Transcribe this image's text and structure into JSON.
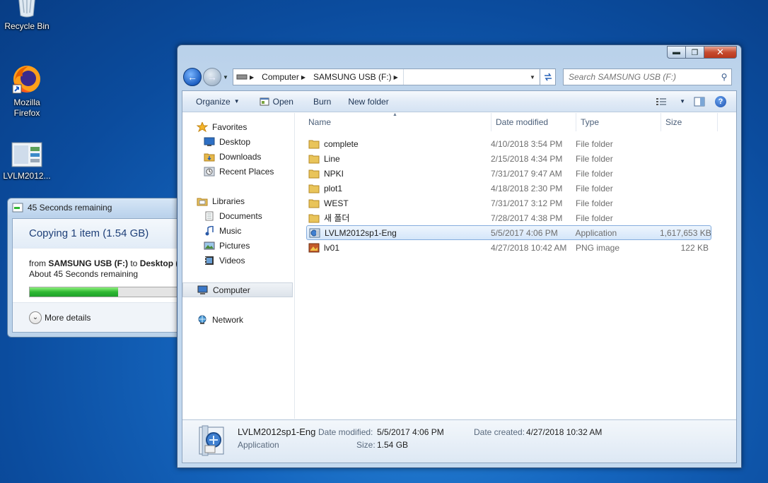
{
  "desktop": {
    "icons": [
      {
        "label": "Recycle Bin"
      },
      {
        "label": "Mozilla Firefox"
      },
      {
        "label": "LVLM2012..."
      }
    ]
  },
  "copy_dialog": {
    "title": "45 Seconds remaining",
    "heading": "Copying 1 item (1.54 GB)",
    "from_prefix": "from ",
    "from_name": "SAMSUNG USB (F:)",
    "to_word": " to ",
    "to_name": "Desktop (",
    "time_left": "About 45 Seconds remaining",
    "progress_fraction": 0.6,
    "more_details": "More details"
  },
  "explorer": {
    "window_buttons": {
      "minimize": "▬",
      "maximize": "❐",
      "close": "✕"
    },
    "address": {
      "segments": [
        "Computer",
        "SAMSUNG USB (F:)"
      ]
    },
    "search": {
      "placeholder": "Search SAMSUNG USB (F:)"
    },
    "toolbar": {
      "organize": "Organize",
      "open": "Open",
      "burn": "Burn",
      "new_folder": "New folder",
      "help": "?"
    },
    "nav": {
      "favorites": "Favorites",
      "desktop": "Desktop",
      "downloads": "Downloads",
      "recent_places": "Recent Places",
      "libraries": "Libraries",
      "documents": "Documents",
      "music": "Music",
      "pictures": "Pictures",
      "videos": "Videos",
      "computer": "Computer",
      "network": "Network"
    },
    "columns": {
      "name": "Name",
      "date": "Date modified",
      "type": "Type",
      "size": "Size"
    },
    "files": [
      {
        "name": "complete",
        "date": "4/10/2018 3:54 PM",
        "type": "File folder",
        "size": ""
      },
      {
        "name": "Line",
        "date": "2/15/2018 4:34 PM",
        "type": "File folder",
        "size": ""
      },
      {
        "name": "NPKI",
        "date": "7/31/2017 9:47 AM",
        "type": "File folder",
        "size": ""
      },
      {
        "name": "plot1",
        "date": "4/18/2018 2:30 PM",
        "type": "File folder",
        "size": ""
      },
      {
        "name": "WEST",
        "date": "7/31/2017 3:12 PM",
        "type": "File folder",
        "size": ""
      },
      {
        "name": "새 폴더",
        "date": "7/28/2017 4:38 PM",
        "type": "File folder",
        "size": ""
      },
      {
        "name": "LVLM2012sp1-Eng",
        "date": "5/5/2017 4:06 PM",
        "type": "Application",
        "size": "1,617,653 KB"
      },
      {
        "name": "lv01",
        "date": "4/27/2018 10:42 AM",
        "type": "PNG image",
        "size": "122 KB"
      }
    ],
    "details": {
      "name": "LVLM2012sp1-Eng",
      "kind": "Application",
      "date_modified_label": "Date modified:",
      "date_modified": "5/5/2017 4:06 PM",
      "size_label": "Size:",
      "size": "1.54 GB",
      "date_created_label": "Date created:",
      "date_created": "4/27/2018 10:32 AM"
    }
  }
}
